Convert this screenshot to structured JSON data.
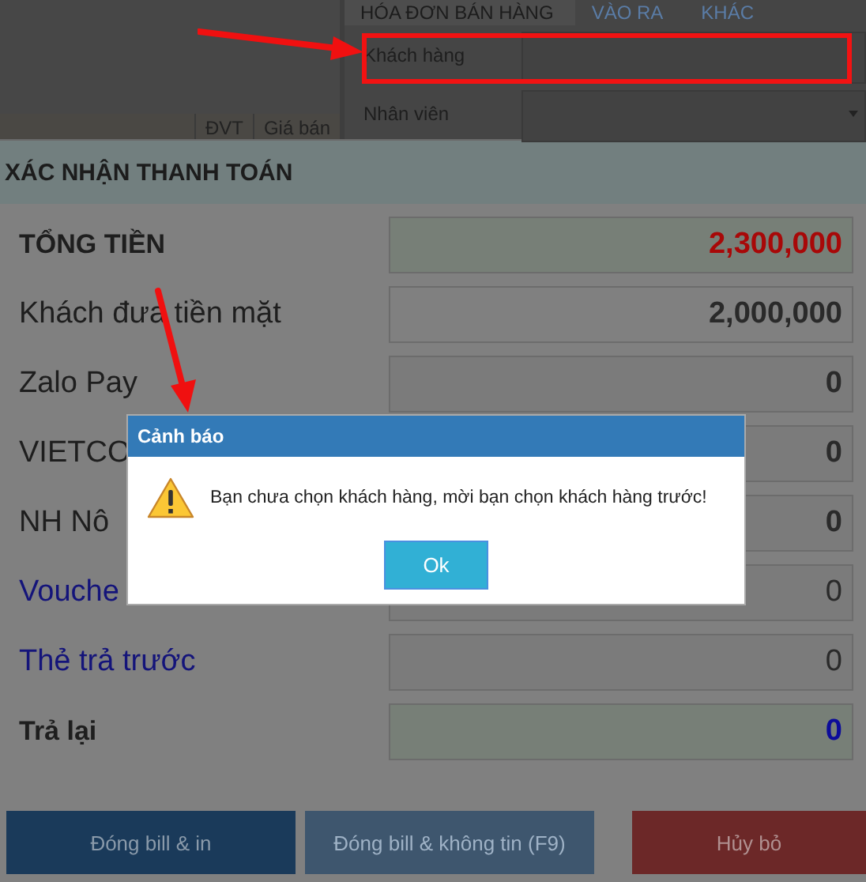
{
  "background": {
    "table_columns": [
      "ĐVT",
      "Giá bán"
    ],
    "tabs": [
      {
        "label": "HÓA ĐƠN BÁN HÀNG",
        "selected": true
      },
      {
        "label": "VÀO RA",
        "selected": false
      },
      {
        "label": "KHÁC",
        "selected": false
      }
    ],
    "fields": [
      {
        "label": "Khách hàng",
        "highlighted": true,
        "dropdown": false
      },
      {
        "label": "Nhân viên",
        "highlighted": false,
        "dropdown": true
      }
    ]
  },
  "payment_dialog": {
    "title": "XÁC NHẬN THANH TOÁN",
    "rows": [
      {
        "kind": "total",
        "label": "TỔNG TIỀN",
        "value": "2,300,000"
      },
      {
        "kind": "cash",
        "label": "Khách đưa tiền mặt",
        "value": "2,000,000"
      },
      {
        "kind": "entry",
        "label": "Zalo Pay",
        "value": "0"
      },
      {
        "kind": "entry",
        "label": "VIETCO",
        "value": "0"
      },
      {
        "kind": "entry",
        "label": "NH Nô",
        "value": "0"
      },
      {
        "kind": "card",
        "label": "Vouche",
        "value": "0"
      },
      {
        "kind": "card",
        "label": "Thẻ trả trước",
        "value": "0"
      },
      {
        "kind": "change",
        "label": "Trả lại",
        "value": "0"
      }
    ],
    "buttons": [
      {
        "kind": "primary",
        "label": "Đóng bill & in",
        "disabled": false
      },
      {
        "kind": "primary",
        "label": "Đóng bill & không tin (F9)",
        "disabled": true
      },
      {
        "kind": "danger",
        "label": "Hủy bỏ",
        "disabled": false
      }
    ]
  },
  "alert": {
    "title": "Cảnh báo",
    "message": "Bạn chưa chọn khách hàng, mời bạn chọn khách hàng trước!",
    "button": "Ok"
  }
}
